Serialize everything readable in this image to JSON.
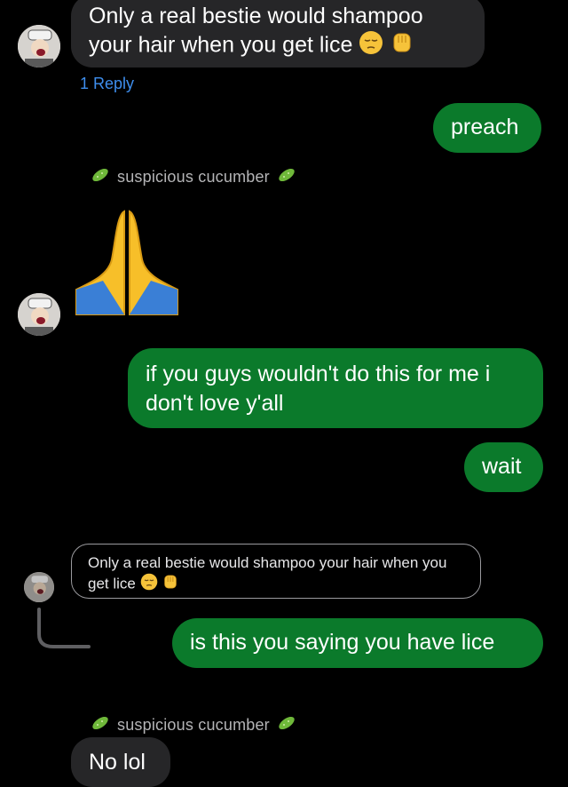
{
  "messages": {
    "first_incoming": {
      "text": "Only a real bestie would shampoo your hair when you get lice"
    },
    "reply_count": "1 Reply",
    "outgoing_1": "preach",
    "sender_name": "suspicious cucumber",
    "outgoing_2": "if you guys wouldn't do this for me i don't love y'all",
    "outgoing_3": "wait",
    "quoted": "Only a real bestie would shampoo your hair when you get lice",
    "outgoing_4": "is this you saying you have lice",
    "sender_name_2": "suspicious cucumber",
    "last_incoming": "No lol"
  },
  "colors": {
    "outgoing_bubble": "#0b7a2b",
    "incoming_bubble": "#262628",
    "reply_link": "#3e8eed"
  },
  "icons": [
    "pensive-face-icon",
    "raised-fist-icon",
    "cucumber-icon",
    "praying-hands-icon",
    "thread-connector-icon"
  ]
}
